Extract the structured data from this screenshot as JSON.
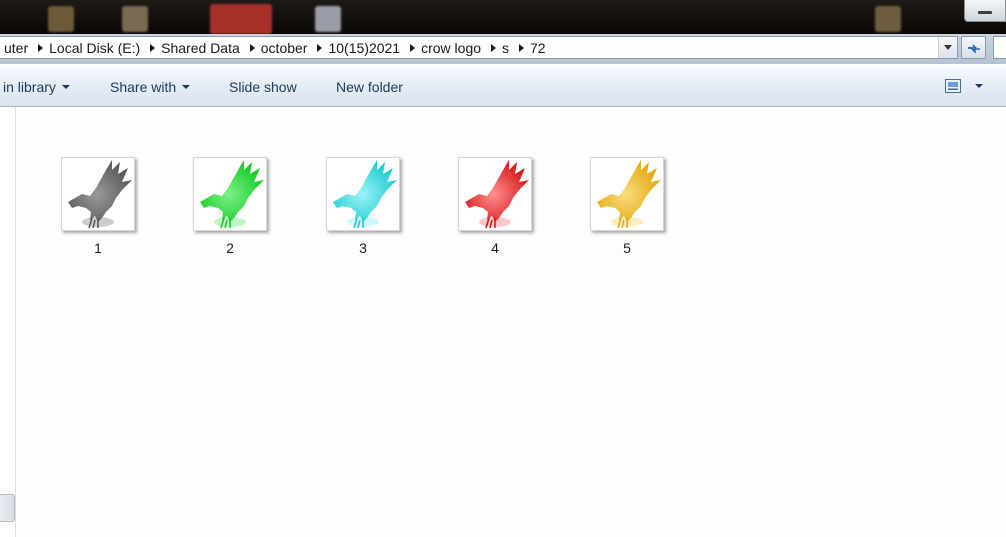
{
  "address_bar": {
    "breadcrumbs": [
      "uter",
      "Local Disk (E:)",
      "Shared Data",
      "october",
      "10(15)2021",
      "crow logo",
      "s",
      "72"
    ]
  },
  "toolbar": {
    "include_in_library": "in library",
    "share_with": "Share with",
    "slide_show": "Slide show",
    "new_folder": "New folder"
  },
  "files": [
    {
      "name": "1",
      "color": "#555555",
      "glow": "#999999"
    },
    {
      "name": "2",
      "color": "#10c81e",
      "glow": "#7cf08a"
    },
    {
      "name": "3",
      "color": "#14c9cf",
      "glow": "#9df3f6"
    },
    {
      "name": "4",
      "color": "#d41012",
      "glow": "#ff8f90"
    },
    {
      "name": "5",
      "color": "#e2a60c",
      "glow": "#f8dc7c"
    }
  ],
  "icons": {
    "refresh": "refresh-icon",
    "view": "change-view-icon",
    "minimize": "minimize-icon"
  }
}
